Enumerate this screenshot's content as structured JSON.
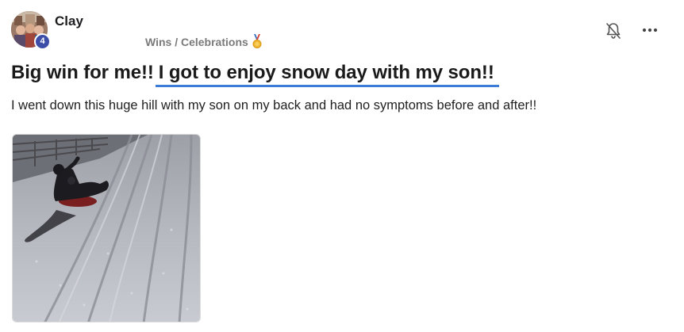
{
  "post": {
    "author": {
      "name": "Clay",
      "level": "4",
      "avatar": "avatar"
    },
    "category": "Wins / Celebrations",
    "category_icon": "medal-icon",
    "title_prefix": "Big win for me!!",
    "title_highlight": "I got to enjoy snow day with my son!!",
    "body": "I went down this huge hill with my son on my back and had no symptoms before and after!!",
    "icons": {
      "notifications": "bell-icon",
      "more": "more-icon"
    },
    "photo": "snow-sled-photo"
  },
  "colors": {
    "accent_underline": "#3d7bd9",
    "badge": "#3c4ea8",
    "category_text": "#7a7a7a"
  }
}
